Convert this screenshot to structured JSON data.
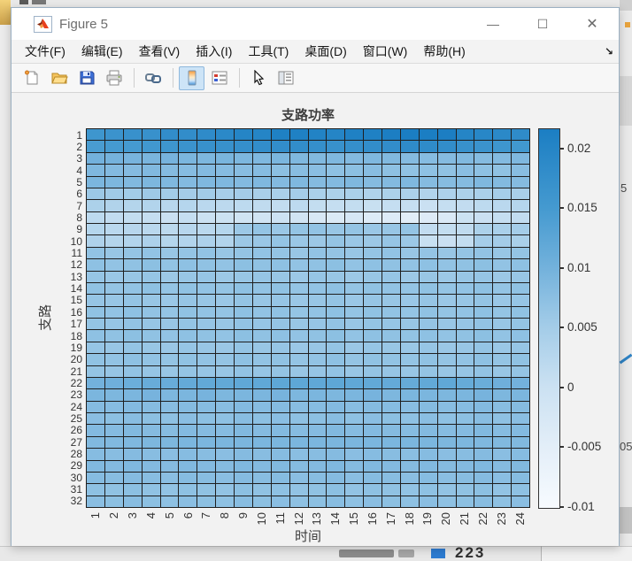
{
  "window": {
    "title": "Figure 5",
    "controls": {
      "minimize": "—",
      "maximize": "☐",
      "close": "✕"
    }
  },
  "menu": {
    "items": [
      "文件(F)",
      "编辑(E)",
      "查看(V)",
      "插入(I)",
      "工具(T)",
      "桌面(D)",
      "窗口(W)",
      "帮助(H)"
    ],
    "overflow_glyph": "↘"
  },
  "toolbar": {
    "icons": [
      "new-figure-icon",
      "open-file-icon",
      "save-icon",
      "print-icon",
      "separator",
      "link-plot-icon",
      "separator",
      "insert-colorbar-icon",
      "insert-legend-icon",
      "separator",
      "edit-plot-icon",
      "property-inspector-icon"
    ],
    "active_icon": "insert-colorbar-icon"
  },
  "figure": {
    "title": "支路功率",
    "xlabel": "时间",
    "ylabel": "支路"
  },
  "background": {
    "fragments": {
      "right_a": "5",
      "right_b": "05",
      "bottom": "223"
    }
  },
  "chart_data": {
    "type": "heatmap",
    "title": "支路功率",
    "xlabel": "时间",
    "ylabel": "支路",
    "x": [
      1,
      2,
      3,
      4,
      5,
      6,
      7,
      8,
      9,
      10,
      11,
      12,
      13,
      14,
      15,
      16,
      17,
      18,
      19,
      20,
      21,
      22,
      23,
      24
    ],
    "y": [
      1,
      2,
      3,
      4,
      5,
      6,
      7,
      8,
      9,
      10,
      11,
      12,
      13,
      14,
      15,
      16,
      17,
      18,
      19,
      20,
      21,
      22,
      23,
      24,
      25,
      26,
      27,
      28,
      29,
      30,
      31,
      32
    ],
    "vmin": -0.0101,
    "vmax": 0.0216,
    "colorbar_ticks": [
      0.02,
      0.015,
      0.01,
      0.005,
      0,
      -0.005,
      -0.01
    ],
    "colorbar_tick_labels": [
      "0.02",
      "0.015",
      "0.01",
      "0.005",
      "0",
      "-0.005",
      "-0.01"
    ],
    "colormap_stops": [
      [
        0,
        "#f7fbff"
      ],
      [
        0.16,
        "#e3eef8"
      ],
      [
        0.32,
        "#cbe1f2"
      ],
      [
        0.48,
        "#a3cce8"
      ],
      [
        0.63,
        "#74b2dc"
      ],
      [
        0.79,
        "#459ad0"
      ],
      [
        1,
        "#1b7ec3"
      ]
    ],
    "grid": true,
    "values": [
      [
        0.016,
        0.0165,
        0.017,
        0.017,
        0.018,
        0.018,
        0.0185,
        0.019,
        0.02,
        0.02,
        0.021,
        0.021,
        0.0205,
        0.02,
        0.021,
        0.021,
        0.0215,
        0.022,
        0.022,
        0.0215,
        0.02,
        0.0195,
        0.019,
        0.0185
      ],
      [
        0.0145,
        0.015,
        0.015,
        0.0155,
        0.016,
        0.0165,
        0.017,
        0.017,
        0.0175,
        0.018,
        0.018,
        0.018,
        0.0175,
        0.017,
        0.0175,
        0.018,
        0.018,
        0.0185,
        0.0185,
        0.018,
        0.017,
        0.0165,
        0.016,
        0.0155
      ],
      [
        0.01,
        0.0098,
        0.0095,
        0.0093,
        0.0096,
        0.0092,
        0.009,
        0.0094,
        0.009,
        0.0088,
        0.0092,
        0.0088,
        0.0086,
        0.0088,
        0.0084,
        0.0088,
        0.0086,
        0.0082,
        0.008,
        0.0082,
        0.0086,
        0.0082,
        0.0084,
        0.0088
      ],
      [
        0.0088,
        0.0084,
        0.0082,
        0.0086,
        0.0082,
        0.008,
        0.0084,
        0.008,
        0.0078,
        0.008,
        0.0074,
        0.0078,
        0.0076,
        0.0072,
        0.0074,
        0.0078,
        0.0072,
        0.007,
        0.0072,
        0.007,
        0.0076,
        0.0072,
        0.007,
        0.0078
      ],
      [
        0.0092,
        0.009,
        0.0086,
        0.009,
        0.0088,
        0.0084,
        0.0088,
        0.0088,
        0.0084,
        0.0088,
        0.0084,
        0.0088,
        0.0082,
        0.0084,
        0.0088,
        0.0082,
        0.0084,
        0.0088,
        0.0082,
        0.008,
        0.0082,
        0.0088,
        0.0084,
        0.0082
      ],
      [
        0.0058,
        0.0054,
        0.0052,
        0.0056,
        0.0052,
        0.005,
        0.0052,
        0.0046,
        0.005,
        0.0044,
        0.0042,
        0.0048,
        0.0042,
        0.004,
        0.0042,
        0.0036,
        0.004,
        0.004,
        0.0034,
        0.0038,
        0.004,
        0.0042,
        0.0048,
        0.0044
      ],
      [
        0.004,
        0.0034,
        0.003,
        0.0032,
        0.0024,
        0.0028,
        0.0022,
        0.002,
        0.0018,
        0.0014,
        0.0012,
        0.0018,
        0.001,
        0.0008,
        0.001,
        0.0004,
        0.0008,
        0.0008,
        0.0002,
        0.0008,
        0.0012,
        0.0018,
        0.0022,
        0.0028
      ],
      [
        0.0018,
        0.0012,
        0.001,
        0.0008,
        0.0002,
        0.0008,
        0,
        -0.0002,
        -0.001,
        -0.0012,
        -0.0004,
        -0.0012,
        -0.0028,
        -0.0034,
        -0.0022,
        -0.0038,
        -0.0038,
        -0.0046,
        -0.004,
        -0.0032,
        -0.0002,
        0.0002,
        0.0008,
        0.0012
      ],
      [
        0.0028,
        0.0022,
        0.0026,
        0.0022,
        0.002,
        0.0026,
        0.0022,
        0.0028,
        0.0058,
        0.0066,
        0.006,
        0.0066,
        0.0068,
        0.0062,
        0.0066,
        0.006,
        0.0062,
        0.0066,
        0.0012,
        0.001,
        0.0014,
        0.004,
        0.0042,
        0.0048
      ],
      [
        0.0036,
        0.003,
        0.0032,
        0.0038,
        0.003,
        0.0032,
        0.0038,
        0.0032,
        0.0058,
        0.006,
        0.0066,
        0.006,
        0.0058,
        0.0066,
        0.006,
        0.0058,
        0.0064,
        0.0058,
        0.0004,
        0.0002,
        0.001,
        0.0048,
        0.005,
        0.0042
      ],
      [
        0.0068,
        0.0062,
        0.0066,
        0.0068,
        0.0062,
        0.0066,
        0.0068,
        0.0062,
        0.0066,
        0.0068,
        0.0066,
        0.0062,
        0.0068,
        0.0066,
        0.0062,
        0.0066,
        0.0068,
        0.0062,
        0.0066,
        0.0062,
        0.0066,
        0.0068,
        0.0062,
        0.0066
      ],
      [
        0.0072,
        0.0068,
        0.007,
        0.0074,
        0.0068,
        0.0072,
        0.007,
        0.0068,
        0.0074,
        0.007,
        0.0072,
        0.0068,
        0.007,
        0.0074,
        0.0068,
        0.0072,
        0.007,
        0.0068,
        0.0072,
        0.0068,
        0.007,
        0.0074,
        0.0068,
        0.0072
      ],
      [
        0.0064,
        0.006,
        0.0062,
        0.0064,
        0.0058,
        0.0062,
        0.0064,
        0.0058,
        0.0062,
        0.0064,
        0.0062,
        0.0058,
        0.0064,
        0.0062,
        0.0058,
        0.0062,
        0.0064,
        0.0058,
        0.0062,
        0.0058,
        0.0062,
        0.0064,
        0.0058,
        0.0062
      ],
      [
        0.007,
        0.0066,
        0.0068,
        0.0072,
        0.0066,
        0.007,
        0.0068,
        0.0066,
        0.0072,
        0.0068,
        0.007,
        0.0066,
        0.0068,
        0.0072,
        0.0066,
        0.007,
        0.0068,
        0.0066,
        0.007,
        0.0066,
        0.0068,
        0.0072,
        0.0066,
        0.007
      ],
      [
        0.0064,
        0.0062,
        0.0066,
        0.0062,
        0.006,
        0.0064,
        0.0062,
        0.006,
        0.0066,
        0.0062,
        0.0064,
        0.006,
        0.0062,
        0.0066,
        0.006,
        0.0064,
        0.0062,
        0.006,
        0.0064,
        0.006,
        0.0062,
        0.0066,
        0.006,
        0.0064
      ],
      [
        0.007,
        0.0068,
        0.0072,
        0.0068,
        0.0066,
        0.007,
        0.0068,
        0.0066,
        0.0072,
        0.0068,
        0.007,
        0.0066,
        0.0068,
        0.0072,
        0.0066,
        0.007,
        0.0068,
        0.0066,
        0.007,
        0.0066,
        0.0068,
        0.0072,
        0.0066,
        0.007
      ],
      [
        0.0066,
        0.0064,
        0.0068,
        0.0064,
        0.0062,
        0.0066,
        0.0064,
        0.0062,
        0.0068,
        0.0064,
        0.0066,
        0.0062,
        0.0064,
        0.0068,
        0.0062,
        0.0066,
        0.0064,
        0.0062,
        0.0066,
        0.0062,
        0.0064,
        0.0068,
        0.0062,
        0.0066
      ],
      [
        0.0072,
        0.007,
        0.0074,
        0.007,
        0.0068,
        0.0072,
        0.007,
        0.0068,
        0.0074,
        0.007,
        0.0072,
        0.0068,
        0.007,
        0.0074,
        0.0068,
        0.0072,
        0.007,
        0.0068,
        0.0072,
        0.0068,
        0.007,
        0.0074,
        0.0068,
        0.0072
      ],
      [
        0.0064,
        0.0062,
        0.0066,
        0.0062,
        0.006,
        0.0064,
        0.0062,
        0.006,
        0.0066,
        0.0062,
        0.0064,
        0.006,
        0.0062,
        0.0066,
        0.006,
        0.0064,
        0.0062,
        0.006,
        0.0064,
        0.006,
        0.0062,
        0.0066,
        0.006,
        0.0064
      ],
      [
        0.007,
        0.0068,
        0.0072,
        0.0068,
        0.0066,
        0.007,
        0.0068,
        0.0066,
        0.0072,
        0.0068,
        0.007,
        0.0066,
        0.0068,
        0.0072,
        0.0066,
        0.007,
        0.0068,
        0.0066,
        0.007,
        0.0066,
        0.0068,
        0.0072,
        0.0066,
        0.007
      ],
      [
        0.0066,
        0.0064,
        0.0068,
        0.0064,
        0.0062,
        0.0066,
        0.0064,
        0.0062,
        0.0068,
        0.0064,
        0.0066,
        0.0062,
        0.0064,
        0.0068,
        0.0062,
        0.0066,
        0.0064,
        0.0062,
        0.0066,
        0.0062,
        0.0064,
        0.0068,
        0.0062,
        0.0066
      ],
      [
        0.01,
        0.0104,
        0.0108,
        0.0112,
        0.0112,
        0.0116,
        0.0118,
        0.0118,
        0.012,
        0.012,
        0.0122,
        0.0122,
        0.012,
        0.0122,
        0.012,
        0.0118,
        0.0116,
        0.0114,
        0.0118,
        0.012,
        0.0114,
        0.011,
        0.0104,
        0.01
      ],
      [
        0.0092,
        0.009,
        0.0092,
        0.0096,
        0.009,
        0.0092,
        0.0096,
        0.009,
        0.0092,
        0.0092,
        0.0096,
        0.009,
        0.0092,
        0.009,
        0.0092,
        0.0096,
        0.009,
        0.0092,
        0.0092,
        0.009,
        0.0092,
        0.0096,
        0.009,
        0.0092
      ],
      [
        0.0082,
        0.008,
        0.0084,
        0.008,
        0.0078,
        0.0082,
        0.008,
        0.0078,
        0.0084,
        0.008,
        0.0082,
        0.0078,
        0.008,
        0.0084,
        0.0078,
        0.0082,
        0.008,
        0.0078,
        0.0082,
        0.0078,
        0.008,
        0.0084,
        0.0078,
        0.0082
      ],
      [
        0.0076,
        0.0074,
        0.0078,
        0.0074,
        0.0072,
        0.0076,
        0.0074,
        0.0072,
        0.0078,
        0.0074,
        0.0076,
        0.0072,
        0.0074,
        0.0078,
        0.0072,
        0.0076,
        0.0074,
        0.0072,
        0.0076,
        0.0072,
        0.0074,
        0.0078,
        0.0072,
        0.0076
      ],
      [
        0.0084,
        0.0082,
        0.0086,
        0.0082,
        0.008,
        0.0084,
        0.0082,
        0.008,
        0.0086,
        0.0082,
        0.0084,
        0.008,
        0.0082,
        0.0086,
        0.008,
        0.0084,
        0.0082,
        0.008,
        0.0084,
        0.008,
        0.0082,
        0.0086,
        0.008,
        0.0084
      ],
      [
        0.0086,
        0.0086,
        0.0088,
        0.009,
        0.009,
        0.0092,
        0.0092,
        0.0092,
        0.0092,
        0.0092,
        0.0092,
        0.0092,
        0.0092,
        0.0092,
        0.0092,
        0.0092,
        0.0092,
        0.0092,
        0.0092,
        0.009,
        0.009,
        0.0088,
        0.0086,
        0.0086
      ],
      [
        0.008,
        0.0078,
        0.0082,
        0.0078,
        0.0076,
        0.008,
        0.0078,
        0.0076,
        0.0082,
        0.0078,
        0.008,
        0.0076,
        0.0078,
        0.0082,
        0.0076,
        0.008,
        0.0078,
        0.0076,
        0.008,
        0.0076,
        0.0078,
        0.0082,
        0.0076,
        0.008
      ],
      [
        0.0086,
        0.0084,
        0.0088,
        0.0084,
        0.0082,
        0.0086,
        0.0084,
        0.0082,
        0.0088,
        0.0084,
        0.0086,
        0.0082,
        0.0084,
        0.0088,
        0.0082,
        0.0086,
        0.0084,
        0.0082,
        0.0086,
        0.0082,
        0.0084,
        0.0088,
        0.0082,
        0.0086
      ],
      [
        0.008,
        0.0078,
        0.0082,
        0.0078,
        0.0076,
        0.008,
        0.0078,
        0.0076,
        0.0082,
        0.0078,
        0.008,
        0.0076,
        0.0078,
        0.0082,
        0.0076,
        0.008,
        0.0078,
        0.0076,
        0.008,
        0.0076,
        0.0078,
        0.0082,
        0.0076,
        0.008
      ],
      [
        0.0072,
        0.007,
        0.0074,
        0.007,
        0.0068,
        0.0072,
        0.007,
        0.0068,
        0.0074,
        0.007,
        0.0072,
        0.0068,
        0.007,
        0.0074,
        0.0068,
        0.0072,
        0.007,
        0.0068,
        0.0072,
        0.0068,
        0.007,
        0.0074,
        0.0068,
        0.0072
      ],
      [
        0.0076,
        0.0074,
        0.0078,
        0.0074,
        0.0072,
        0.0076,
        0.0074,
        0.0072,
        0.0078,
        0.0074,
        0.0076,
        0.0072,
        0.0074,
        0.0078,
        0.0072,
        0.0076,
        0.0074,
        0.0072,
        0.0076,
        0.0072,
        0.0074,
        0.0078,
        0.0072,
        0.0076
      ]
    ]
  }
}
